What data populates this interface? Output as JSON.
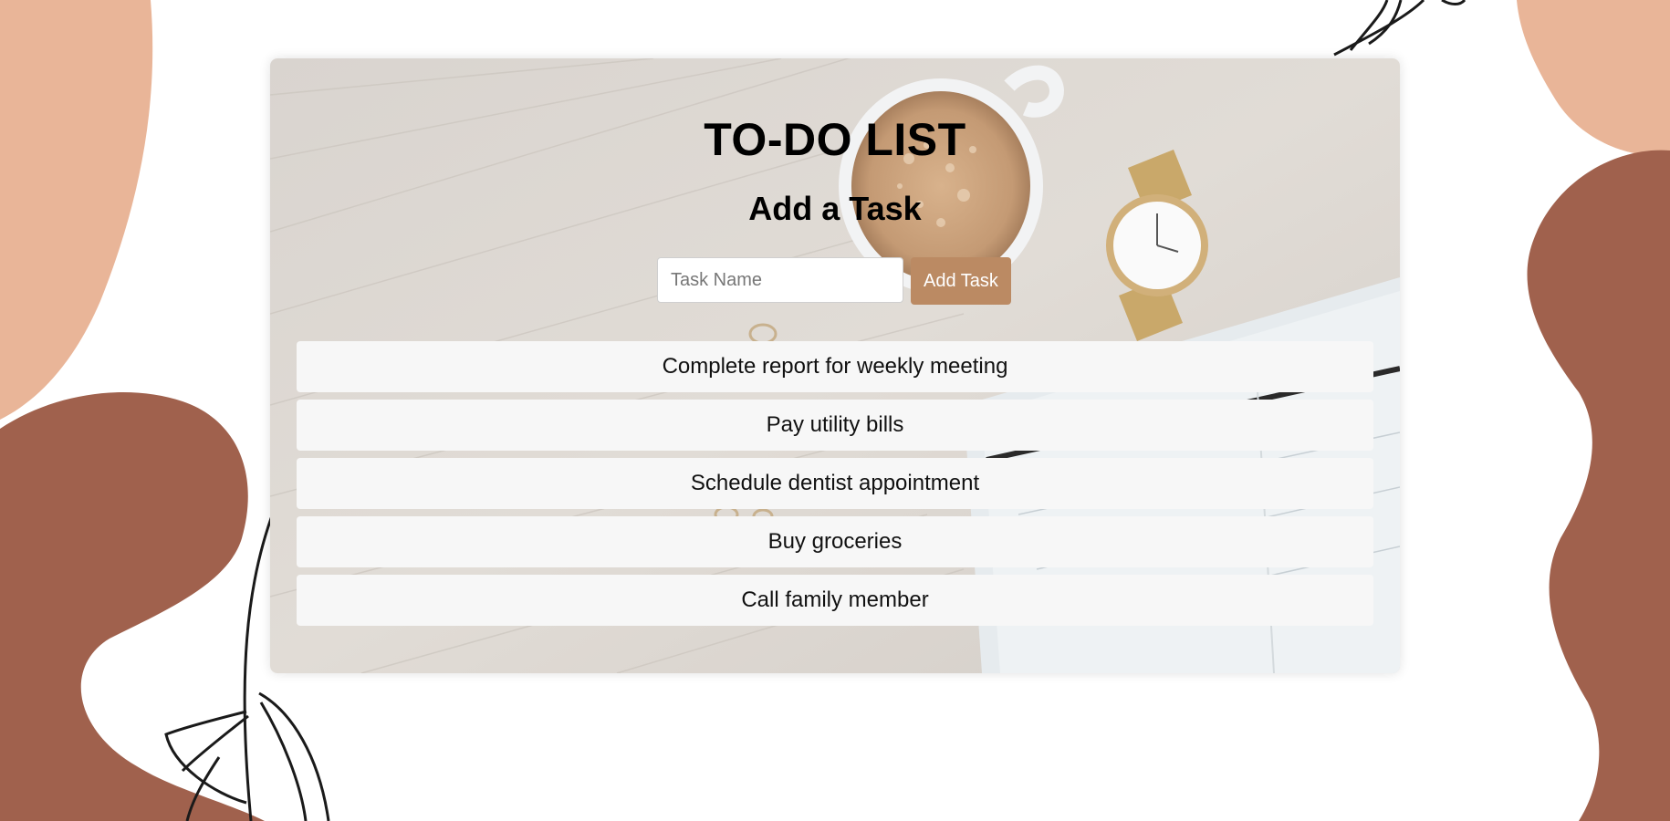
{
  "app": {
    "title": "TO-DO LIST",
    "subtitle": "Add a Task"
  },
  "form": {
    "input_placeholder": "Task Name",
    "input_value": "",
    "add_button_label": "Add Task"
  },
  "tasks": [
    {
      "label": "Complete report for weekly meeting"
    },
    {
      "label": "Pay utility bills"
    },
    {
      "label": "Schedule dentist appointment"
    },
    {
      "label": "Buy groceries"
    },
    {
      "label": "Call family member"
    }
  ],
  "colors": {
    "accent": "#bb8a63",
    "blob_light": "#e9b598",
    "blob_dark": "#a0614d",
    "task_bg": "#f7f7f7"
  },
  "icons": [
    "coffee-mug-illustration",
    "wristwatch-illustration",
    "leaf-branch-illustration"
  ]
}
